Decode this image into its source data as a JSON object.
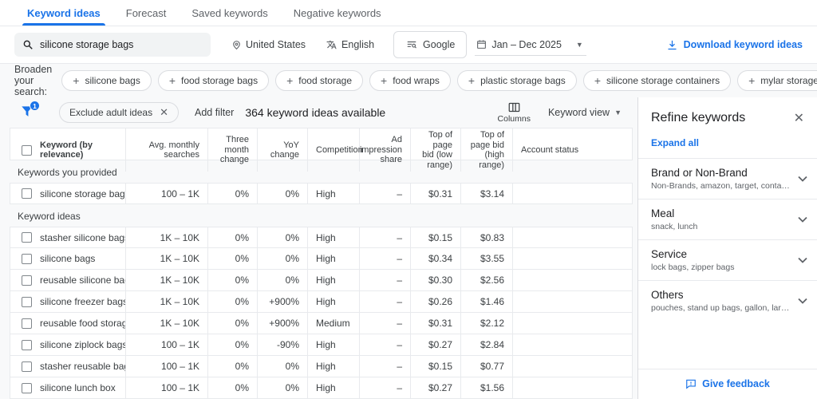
{
  "tabs": [
    {
      "label": "Keyword ideas",
      "active": true
    },
    {
      "label": "Forecast",
      "active": false
    },
    {
      "label": "Saved keywords",
      "active": false
    },
    {
      "label": "Negative keywords",
      "active": false
    }
  ],
  "search": {
    "query": "silicone storage bags",
    "location": "United States",
    "language": "English",
    "network": "Google",
    "date_range": "Jan – Dec 2025",
    "download_label": "Download keyword ideas"
  },
  "broaden": {
    "label": "Broaden your search:",
    "chips": [
      "silicone bags",
      "food storage bags",
      "food storage",
      "food wraps",
      "plastic storage bags",
      "silicone storage containers",
      "mylar storage bags"
    ]
  },
  "toolbar": {
    "filter_count": "1",
    "exclude_chip": "Exclude adult ideas",
    "add_filter_label": "Add filter",
    "results_text": "364 keyword ideas available",
    "columns_label": "Columns",
    "view_label": "Keyword view"
  },
  "table": {
    "columns": [
      "Keyword (by relevance)",
      "Avg. monthly searches",
      "Three month change",
      "YoY change",
      "Competition",
      "Ad impression share",
      "Top of page bid (low range)",
      "Top of page bid (high range)",
      "Account status"
    ],
    "sections": [
      {
        "label": "Keywords you provided",
        "rows": [
          {
            "keyword": "silicone storage bags",
            "avg_monthly_searches": "100 – 1K",
            "three_month_change": "0%",
            "yoy_change": "0%",
            "competition": "High",
            "ad_impression_share": "–",
            "bid_low": "$0.31",
            "bid_high": "$3.14",
            "account_status": ""
          }
        ]
      },
      {
        "label": "Keyword ideas",
        "rows": [
          {
            "keyword": "stasher silicone bags",
            "avg_monthly_searches": "1K – 10K",
            "three_month_change": "0%",
            "yoy_change": "0%",
            "competition": "High",
            "ad_impression_share": "–",
            "bid_low": "$0.15",
            "bid_high": "$0.83",
            "account_status": ""
          },
          {
            "keyword": "silicone bags",
            "avg_monthly_searches": "1K – 10K",
            "three_month_change": "0%",
            "yoy_change": "0%",
            "competition": "High",
            "ad_impression_share": "–",
            "bid_low": "$0.34",
            "bid_high": "$3.55",
            "account_status": ""
          },
          {
            "keyword": "reusable silicone bags",
            "avg_monthly_searches": "1K – 10K",
            "three_month_change": "0%",
            "yoy_change": "0%",
            "competition": "High",
            "ad_impression_share": "–",
            "bid_low": "$0.30",
            "bid_high": "$2.56",
            "account_status": ""
          },
          {
            "keyword": "silicone freezer bags",
            "avg_monthly_searches": "1K – 10K",
            "three_month_change": "0%",
            "yoy_change": "+900%",
            "competition": "High",
            "ad_impression_share": "–",
            "bid_low": "$0.26",
            "bid_high": "$1.46",
            "account_status": ""
          },
          {
            "keyword": "reusable food storage bags",
            "avg_monthly_searches": "1K – 10K",
            "three_month_change": "0%",
            "yoy_change": "+900%",
            "competition": "Medium",
            "ad_impression_share": "–",
            "bid_low": "$0.31",
            "bid_high": "$2.12",
            "account_status": ""
          },
          {
            "keyword": "silicone ziplock bags",
            "avg_monthly_searches": "100 – 1K",
            "three_month_change": "0%",
            "yoy_change": "-90%",
            "competition": "High",
            "ad_impression_share": "–",
            "bid_low": "$0.27",
            "bid_high": "$2.84",
            "account_status": ""
          },
          {
            "keyword": "stasher reusable bags",
            "avg_monthly_searches": "100 – 1K",
            "three_month_change": "0%",
            "yoy_change": "0%",
            "competition": "High",
            "ad_impression_share": "–",
            "bid_low": "$0.15",
            "bid_high": "$0.77",
            "account_status": ""
          },
          {
            "keyword": "silicone lunch box",
            "avg_monthly_searches": "100 – 1K",
            "three_month_change": "0%",
            "yoy_change": "0%",
            "competition": "High",
            "ad_impression_share": "–",
            "bid_low": "$0.27",
            "bid_high": "$1.56",
            "account_status": ""
          }
        ]
      }
    ]
  },
  "refine_panel": {
    "title": "Refine keywords",
    "expand_all_label": "Expand all",
    "categories": [
      {
        "name": "Brand or Non-Brand",
        "examples": "Non-Brands, amazon, target, container store, ..."
      },
      {
        "name": "Meal",
        "examples": "snack, lunch"
      },
      {
        "name": "Service",
        "examples": "lock bags, zipper bags"
      },
      {
        "name": "Others",
        "examples": "pouches, stand up bags, gallon, large, sandwi..."
      }
    ],
    "feedback_label": "Give feedback"
  },
  "colors": {
    "accent": "#1a73e8"
  }
}
